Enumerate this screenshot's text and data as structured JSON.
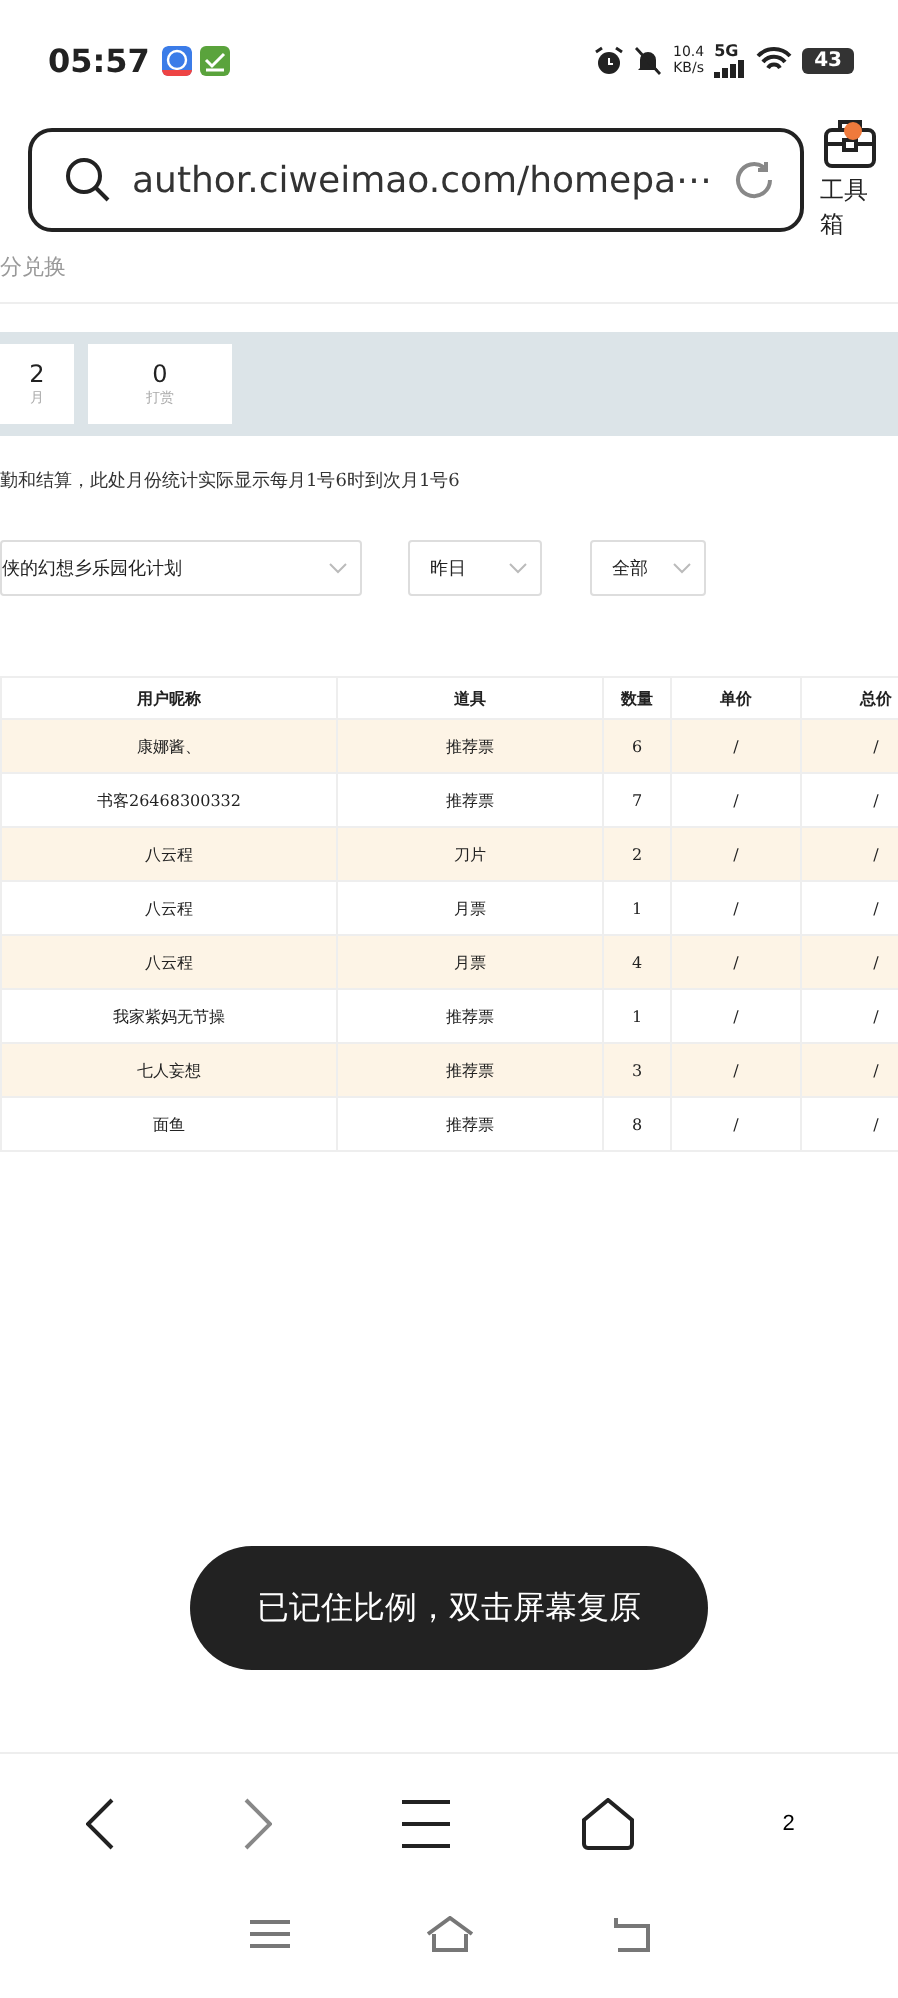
{
  "status_bar": {
    "time": "05:57",
    "net_speed": "10.4",
    "net_unit": "KB/s",
    "network": "5G",
    "battery": "43"
  },
  "address_bar": {
    "url": "author.ciweimao.com/homepa⋯"
  },
  "toolbox": {
    "label": "工具箱",
    "badge": true
  },
  "page": {
    "breadcrumb": "分兑换",
    "stats": [
      {
        "value": "2",
        "label": "月"
      },
      {
        "value": "0",
        "label": "打赏"
      }
    ],
    "notice": "勤和结算，此处月份统计实际显示每月1号6时到次月1号6",
    "filters": [
      {
        "value": "侠的幻想乡乐园化计划"
      },
      {
        "value": "昨日"
      },
      {
        "value": "全部"
      }
    ],
    "table": {
      "columns": [
        "用户昵称",
        "道具",
        "数量",
        "单价",
        "总价"
      ],
      "rows": [
        [
          "康娜酱、",
          "推荐票",
          "6",
          "/",
          "/"
        ],
        [
          "书客26468300332",
          "推荐票",
          "7",
          "/",
          "/"
        ],
        [
          "八云程",
          "刀片",
          "2",
          "/",
          "/"
        ],
        [
          "八云程",
          "月票",
          "1",
          "/",
          "/"
        ],
        [
          "八云程",
          "月票",
          "4",
          "/",
          "/"
        ],
        [
          "我家紫妈无节操",
          "推荐票",
          "1",
          "/",
          "/"
        ],
        [
          "七人妄想",
          "推荐票",
          "3",
          "/",
          "/"
        ],
        [
          "面鱼",
          "推荐票",
          "8",
          "/",
          "/"
        ]
      ]
    }
  },
  "toast": "已记住比例，双击屏幕复原",
  "browser_nav": {
    "tab_count": "2"
  }
}
